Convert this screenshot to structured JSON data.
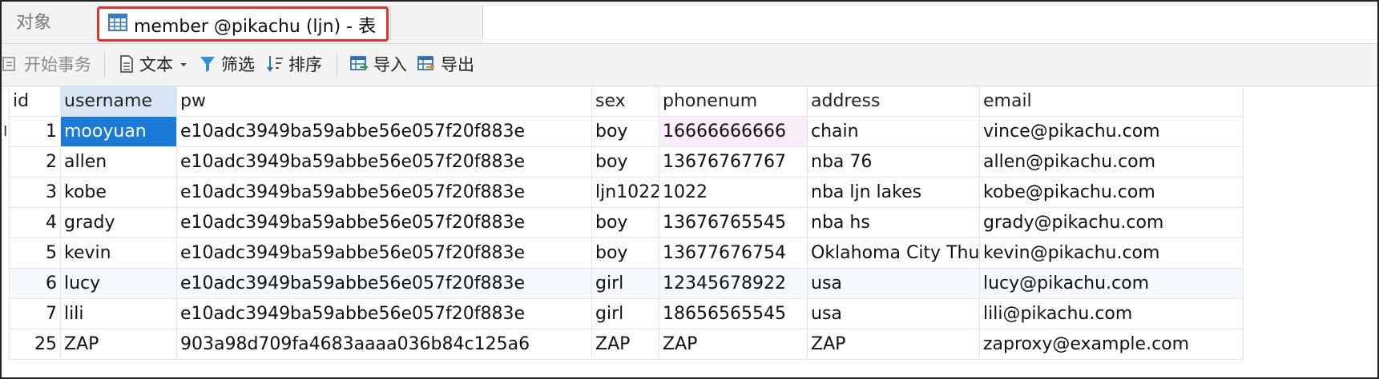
{
  "tabs": {
    "objects_label": "对象",
    "active_label": "member @pikachu (ljn) - 表",
    "highlight_color": "#e53030"
  },
  "toolbar": {
    "begin_transaction": "开始事务",
    "text": "文本",
    "filter": "筛选",
    "sort": "排序",
    "import": "导入",
    "export": "导出"
  },
  "table": {
    "columns": [
      "id",
      "username",
      "pw",
      "sex",
      "phonenum",
      "address",
      "email"
    ],
    "rows": [
      [
        "1",
        "mooyuan",
        "e10adc3949ba59abbe56e057f20f883e",
        "boy",
        "16666666666",
        "chain",
        "vince@pikachu.com"
      ],
      [
        "2",
        "allen",
        "e10adc3949ba59abbe56e057f20f883e",
        "boy",
        "13676767767",
        "nba 76",
        "allen@pikachu.com"
      ],
      [
        "3",
        "kobe",
        "e10adc3949ba59abbe56e057f20f883e",
        "ljn1022",
        "1022",
        "nba ljn lakes",
        "kobe@pikachu.com"
      ],
      [
        "4",
        "grady",
        "e10adc3949ba59abbe56e057f20f883e",
        "boy",
        "13676765545",
        "nba hs",
        "grady@pikachu.com"
      ],
      [
        "5",
        "kevin",
        "e10adc3949ba59abbe56e057f20f883e",
        "boy",
        "13677676754",
        "Oklahoma City Thunder",
        "kevin@pikachu.com"
      ],
      [
        "6",
        "lucy",
        "e10adc3949ba59abbe56e057f20f883e",
        "girl",
        "12345678922",
        "usa",
        "lucy@pikachu.com"
      ],
      [
        "7",
        "lili",
        "e10adc3949ba59abbe56e057f20f883e",
        "girl",
        "18656565545",
        "usa",
        "lili@pikachu.com"
      ],
      [
        "25",
        "ZAP",
        "903a98d709fa4683aaaa036b84c125a6",
        "ZAP",
        "ZAP",
        "ZAP",
        "zaproxy@example.com"
      ]
    ]
  },
  "colors": {
    "selection": "#1b7ad6",
    "header_selected": "#d6e6f5",
    "row_alt": "#f5f9fd"
  }
}
